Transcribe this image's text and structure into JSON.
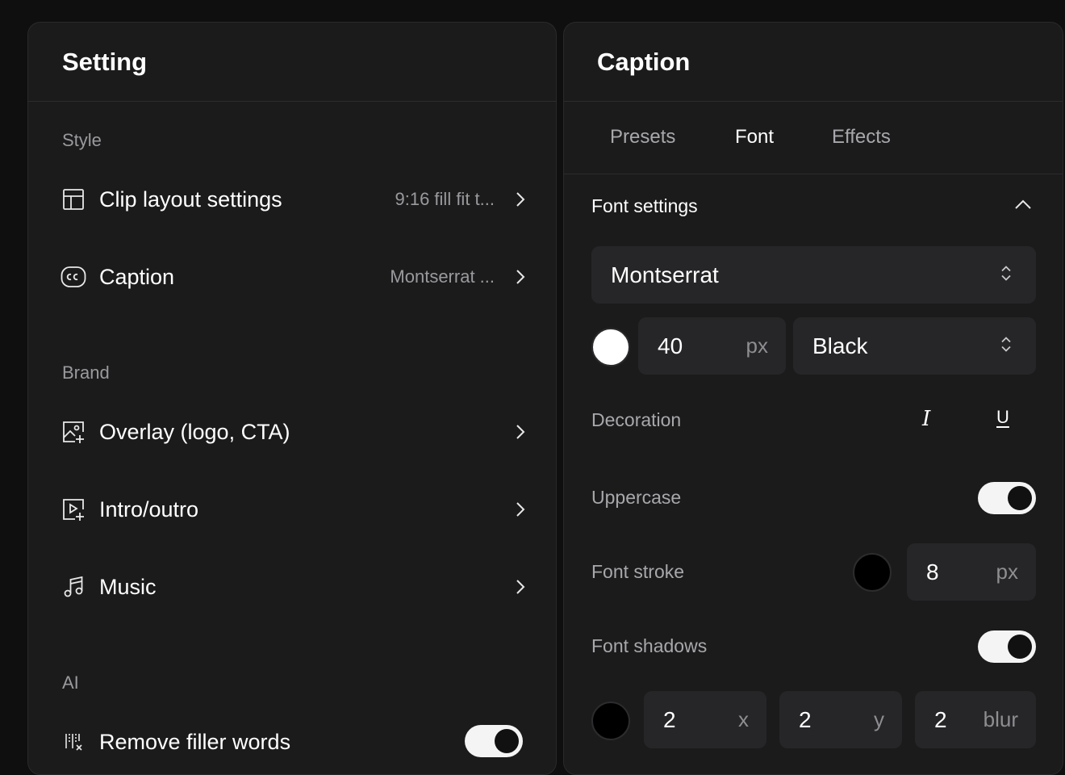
{
  "setting": {
    "title": "Setting",
    "sections": {
      "style": "Style",
      "brand": "Brand",
      "ai": "AI"
    },
    "rows": {
      "clip_layout": {
        "label": "Clip layout settings",
        "value": "9:16 fill fit t..."
      },
      "caption": {
        "label": "Caption",
        "value": "Montserrat ..."
      },
      "overlay": {
        "label": "Overlay (logo, CTA)"
      },
      "intro_outro": {
        "label": "Intro/outro"
      },
      "music": {
        "label": "Music"
      },
      "remove_filler": {
        "label": "Remove filler words",
        "enabled": true
      }
    }
  },
  "caption": {
    "title": "Caption",
    "tabs": [
      "Presets",
      "Font",
      "Effects"
    ],
    "active_tab": "Font",
    "font_settings": {
      "heading": "Font settings",
      "font_family": "Montserrat",
      "font_color": "#ffffff",
      "font_size": "40",
      "font_size_unit": "px",
      "font_weight": "Black",
      "decoration_label": "Decoration",
      "decoration_italic": "I",
      "decoration_underline": "U",
      "uppercase_label": "Uppercase",
      "uppercase_enabled": true,
      "stroke_label": "Font stroke",
      "stroke_color": "#000000",
      "stroke_width": "8",
      "stroke_unit": "px",
      "shadows_label": "Font shadows",
      "shadows_enabled": true,
      "shadow_color": "#000000",
      "shadow_x": "2",
      "shadow_x_unit": "x",
      "shadow_y": "2",
      "shadow_y_unit": "y",
      "shadow_blur": "2",
      "shadow_blur_unit": "blur"
    }
  },
  "icons": {
    "layout": "layout-icon",
    "cc": "closed-caption-icon",
    "overlay": "image-plus-icon",
    "intro": "video-plus-icon",
    "music": "music-note-icon",
    "filler": "filler-words-icon",
    "chevron_right": "chevron-right-icon",
    "chevron_up": "chevron-up-icon",
    "updown": "chevron-updown-icon"
  },
  "colors": {
    "background": "#0f0f10",
    "panel": "#1b1b1c",
    "field": "#262628",
    "muted_text": "#9a9a9e",
    "toggle_on": "#f4f4f4"
  }
}
